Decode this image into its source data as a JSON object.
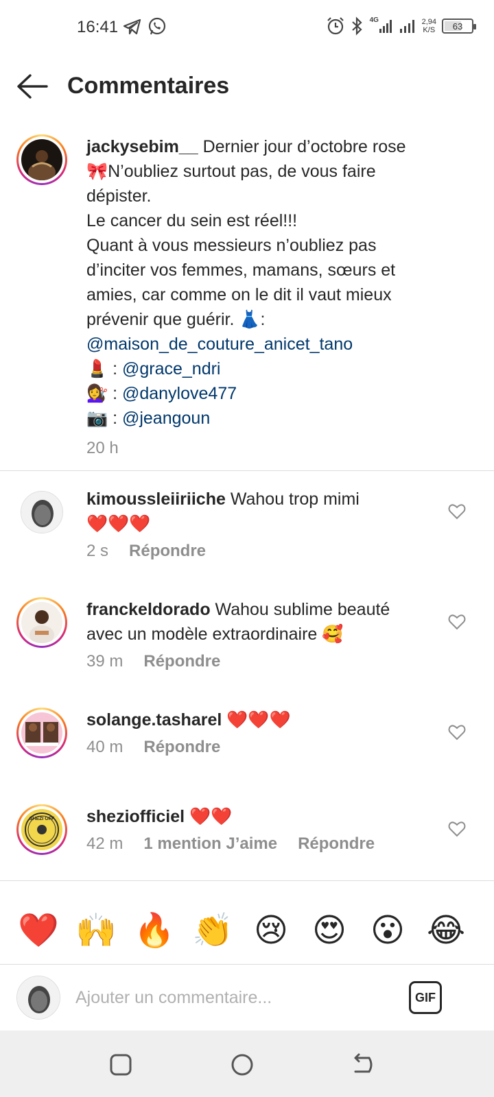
{
  "status_bar": {
    "time": "16:41",
    "network": "4G",
    "speed_value": "2,94",
    "speed_unit": "K/S",
    "battery": "63",
    "battery_level": 0.63
  },
  "header": {
    "title": "Commentaires"
  },
  "caption": {
    "username": "jackysebim__",
    "line1": " Dernier jour d’octobre rose",
    "line2": "🎀N’oubliez surtout pas, de vous faire",
    "line3": "dépister.",
    "line4": "Le cancer du sein est réel!!!",
    "line5": "Quant à vous messieurs n’oubliez pas",
    "line6": "d’inciter vos femmes, mamans, sœurs et",
    "line7": "amies, car comme on le dit il vaut mieux",
    "line8": "prévenir que guérir. 👗:",
    "mention1": "@maison_de_couture_anicet_tano",
    "credit2_prefix": "💄 : ",
    "mention2": "@grace_ndri",
    "credit3_prefix": "💇‍♀️ : ",
    "mention3": "@danylove477",
    "credit4_prefix": "📷 : ",
    "mention4": "@jeangoun",
    "time": "20 h"
  },
  "comments": [
    {
      "username": "kimoussleiiriiche",
      "text_line1": " Wahou trop mimi",
      "text_line2": "❤️❤️❤️",
      "time": "2 s",
      "reply": "Répondre"
    },
    {
      "username": "franckeldorado",
      "text_line1": " Wahou sublime beauté",
      "text_line2": "avec un modèle extraordinaire 🥰",
      "time": "39 m",
      "reply": "Répondre"
    },
    {
      "username": "solange.tasharel",
      "text_line1": " ❤️❤️❤️",
      "time": "40 m",
      "reply": "Répondre"
    },
    {
      "username": "sheziofficiel",
      "text_line1": " ❤️❤️",
      "time": "42 m",
      "likes": "1 mention J’aime",
      "reply": "Répondre"
    }
  ],
  "emoji_bar": [
    "❤️",
    "🙌",
    "🔥",
    "👏",
    "😢",
    "😍",
    "😮",
    "😂"
  ],
  "input": {
    "placeholder": "Ajouter un commentaire...",
    "gif_label": "GIF"
  },
  "avatar_badge_text": "SHEZI OFF"
}
